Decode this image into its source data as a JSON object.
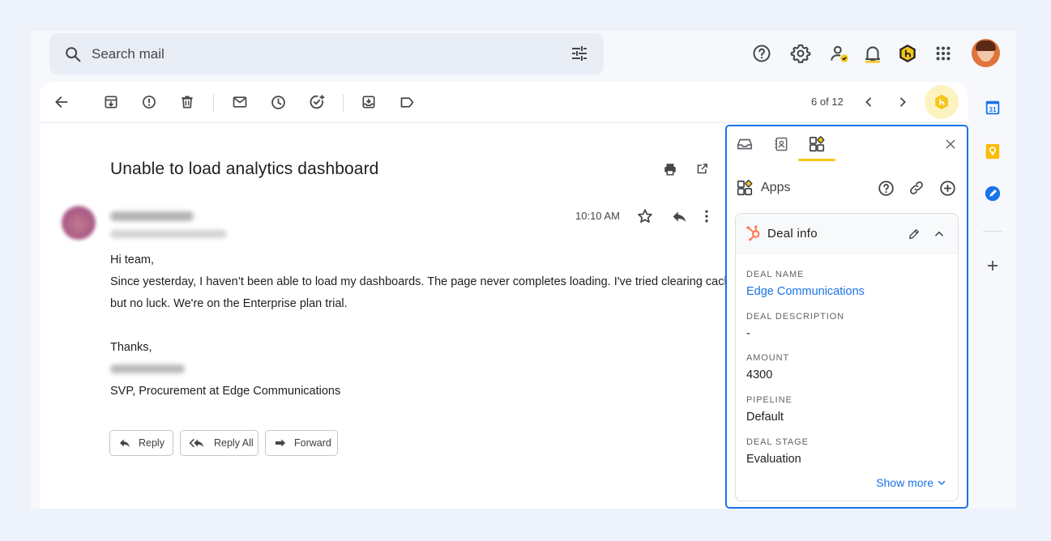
{
  "search": {
    "placeholder": "Search mail"
  },
  "header_icons": [
    "help-icon",
    "settings-icon",
    "account-status-icon",
    "notifications-icon",
    "hubspot-extension-icon",
    "apps-grid-icon",
    "avatar"
  ],
  "toolbar": {
    "page_count": "6 of 12",
    "icons": [
      "back-icon",
      "archive-icon",
      "report-spam-icon",
      "delete-icon",
      "mark-unread-icon",
      "snooze-icon",
      "add-task-icon",
      "move-to-icon",
      "label-icon",
      "chevron-left-icon",
      "chevron-right-icon",
      "hubspot-badge-icon"
    ]
  },
  "email": {
    "subject": "Unable to load analytics dashboard",
    "time": "10:10 AM",
    "body": {
      "greeting": "Hi team,",
      "line1": "Since yesterday, I haven’t been able to load my dashboards. The page never completes loading. I've tried clearing cache",
      "line2": "but no luck. We're on the Enterprise plan trial.",
      "closing": "Thanks,",
      "signature_title": "SVP, Procurement at Edge Communications"
    },
    "actions": {
      "reply": "Reply",
      "reply_all": "Reply All",
      "forward": "Forward"
    }
  },
  "panel": {
    "apps_label": "Apps",
    "card_title": "Deal info",
    "fields": [
      {
        "label": "DEAL NAME",
        "value": "Edge Communications"
      },
      {
        "label": "DEAL DESCRIPTION",
        "value": "-"
      },
      {
        "label": "AMOUNT",
        "value": "4300"
      },
      {
        "label": "PIPELINE",
        "value": "Default"
      },
      {
        "label": "DEAL STAGE",
        "value": "Evaluation"
      }
    ],
    "show_more": "Show more"
  },
  "rail": {
    "calendar_day": "31"
  },
  "colors": {
    "accent_blue": "#1a73e8",
    "hubspot_orange": "#ff7a59",
    "hubspot_yellow": "#f5c518"
  }
}
